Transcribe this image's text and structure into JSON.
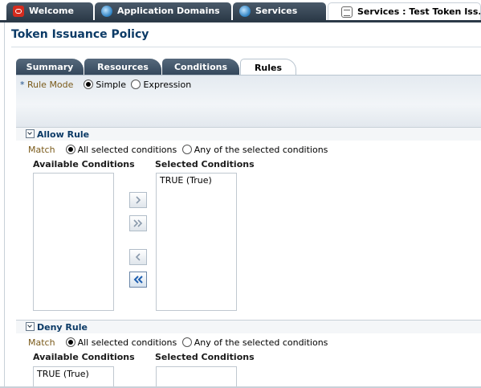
{
  "top_tabs": [
    {
      "label": "Welcome",
      "icon": "oracle-logo-icon",
      "active": false
    },
    {
      "label": "Application Domains",
      "icon": "globe-icon",
      "active": false
    },
    {
      "label": "Services",
      "icon": "globe-icon",
      "active": false
    },
    {
      "label": "Services : Test Token Iss...",
      "icon": "document-icon",
      "active": true
    }
  ],
  "page": {
    "title": "Token Issuance Policy"
  },
  "sub_tabs": [
    {
      "label": "Summary",
      "active": false
    },
    {
      "label": "Resources",
      "active": false
    },
    {
      "label": "Conditions",
      "active": false
    },
    {
      "label": "Rules",
      "active": true
    }
  ],
  "rule_mode": {
    "required_marker": "*",
    "label": "Rule Mode",
    "options": [
      {
        "label": "Simple",
        "selected": true
      },
      {
        "label": "Expression",
        "selected": false
      }
    ]
  },
  "allow_rule": {
    "title": "Allow Rule",
    "match_label": "Match",
    "options": [
      {
        "label": "All selected conditions",
        "selected": true
      },
      {
        "label": "Any of the selected conditions",
        "selected": false
      }
    ],
    "available_header": "Available Conditions",
    "selected_header": "Selected Conditions",
    "available_items": [],
    "selected_items": [
      "TRUE (True)"
    ]
  },
  "deny_rule": {
    "title": "Deny Rule",
    "match_label": "Match",
    "options": [
      {
        "label": "All selected conditions",
        "selected": true
      },
      {
        "label": "Any of the selected conditions",
        "selected": false
      }
    ],
    "available_header": "Available Conditions",
    "selected_header": "Selected Conditions",
    "available_items": [
      "TRUE (True)"
    ],
    "selected_items": []
  },
  "shuttle_buttons": [
    "move-icon",
    "move-all-icon",
    "remove-icon",
    "remove-all-icon"
  ]
}
